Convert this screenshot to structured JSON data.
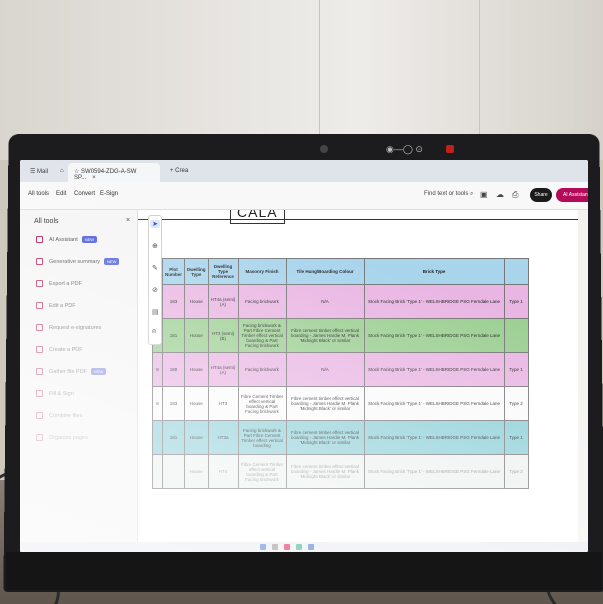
{
  "browser": {
    "tabs": [
      {
        "label": "Mail"
      },
      {
        "label": "SW0594-ZDG-A-SW SP...",
        "close": "×"
      },
      {
        "label": "+ Crea"
      }
    ]
  },
  "toolbar": {
    "menu": [
      "All tools",
      "Edit",
      "Convert",
      "E-Sign"
    ],
    "find_label": "Find text or tools",
    "share_label": "Share",
    "ai_label": "AI Assistant"
  },
  "tools_panel": {
    "title": "All tools",
    "close": "×",
    "items": [
      {
        "label": "AI Assistant",
        "badge": "NEW"
      },
      {
        "label": "Generative summary",
        "badge": "NEW"
      },
      {
        "label": "Export a PDF",
        "badge": ""
      },
      {
        "label": "Edit a PDF",
        "badge": ""
      },
      {
        "label": "Request e-signatures",
        "badge": ""
      },
      {
        "label": "Create a PDF",
        "badge": ""
      },
      {
        "label": "Gather file PDF",
        "badge": "NEW"
      },
      {
        "label": "Fill & Sign",
        "badge": ""
      },
      {
        "label": "Combine files",
        "badge": ""
      },
      {
        "label": "Organize pages",
        "badge": ""
      }
    ]
  },
  "document": {
    "heading": "CALA",
    "columns": [
      "",
      "Plot Number",
      "Dwelling Type",
      "Dwelling Type Reference",
      "Masonry Finish",
      "Tile Hung/Boarding Colour",
      "Brick Type",
      ""
    ],
    "rows": [
      {
        "style": "pink",
        "cells": [
          "9",
          "183",
          "House",
          "HT4a (semi) (A)",
          "Facing brickwork",
          "N/A",
          "Stock Facing Brick 'Type 1' - WELSHBRIDGE PSG Ferndale Lane",
          "Type 1"
        ]
      },
      {
        "style": "green",
        "cells": [
          "",
          "181",
          "House",
          "HT3 (semi) (B)",
          "Facing brickwork & Part Fibre Cement Timber effect vertical boarding & Part Facing brickwork",
          "Fibre cement timber effect vertical boarding - James Hardie M. Plank 'Midnight Black' or similar",
          "Stock Facing Brick 'Type 1' - WELSHBRIDGE PSG Ferndale Lane",
          ""
        ]
      },
      {
        "style": "pink",
        "cells": [
          "8",
          "180",
          "House",
          "HT4a (semi) (A)",
          "Facing brickwork",
          "N/A",
          "Stock Facing Brick 'Type 1' - WELSHBRIDGE PSG Ferndale Lane",
          "Type 1"
        ]
      },
      {
        "style": "white",
        "cells": [
          "6",
          "183",
          "House",
          "HT3",
          "Fibre Cement Timber effect vertical boarding & Part Facing brickwork",
          "Fibre cement timber effect vertical boarding - James Hardie M. Plank 'Midnight Black' or similar",
          "Stock Facing Brick 'Type 1' - WELSHBRIDGE PSG Ferndale Lane",
          "Type 2"
        ]
      },
      {
        "style": "teal",
        "cells": [
          "",
          "181",
          "House",
          "HT3a",
          "Facing brickwork & Part Fibre Cement Timber effect vertical boarding",
          "Fibre cement timber effect vertical boarding - James Hardie M. Plank 'Midnight Black' or similar",
          "Stock Facing Brick 'Type 1' - WELSHBRIDGE PSG Ferndale Lane",
          "Type 1"
        ]
      },
      {
        "style": "faded",
        "cells": [
          "",
          "",
          "House",
          "HT4",
          "Fibre Cement Timber effect vertical boarding & Part Facing brickwork",
          "Fibre cement timber effect vertical boarding - James Hardie M. Plank 'Midnight Black' or similar",
          "Stock Facing Brick 'Type 1' - WELSHBRIDGE PSG Ferndale Lane",
          "Type 2"
        ]
      }
    ]
  },
  "colors": {
    "header_blue": "#a8d4ec",
    "row_pink": "#e9b6e3",
    "row_green": "#9ccf93",
    "row_teal": "#8dcfd8",
    "ai_accent": "#b30b5a"
  },
  "icons": {
    "float_tools": [
      "cursor-icon",
      "zoom-icon",
      "pen-icon",
      "lasso-icon",
      "text-box-icon",
      "stamp-icon"
    ]
  }
}
